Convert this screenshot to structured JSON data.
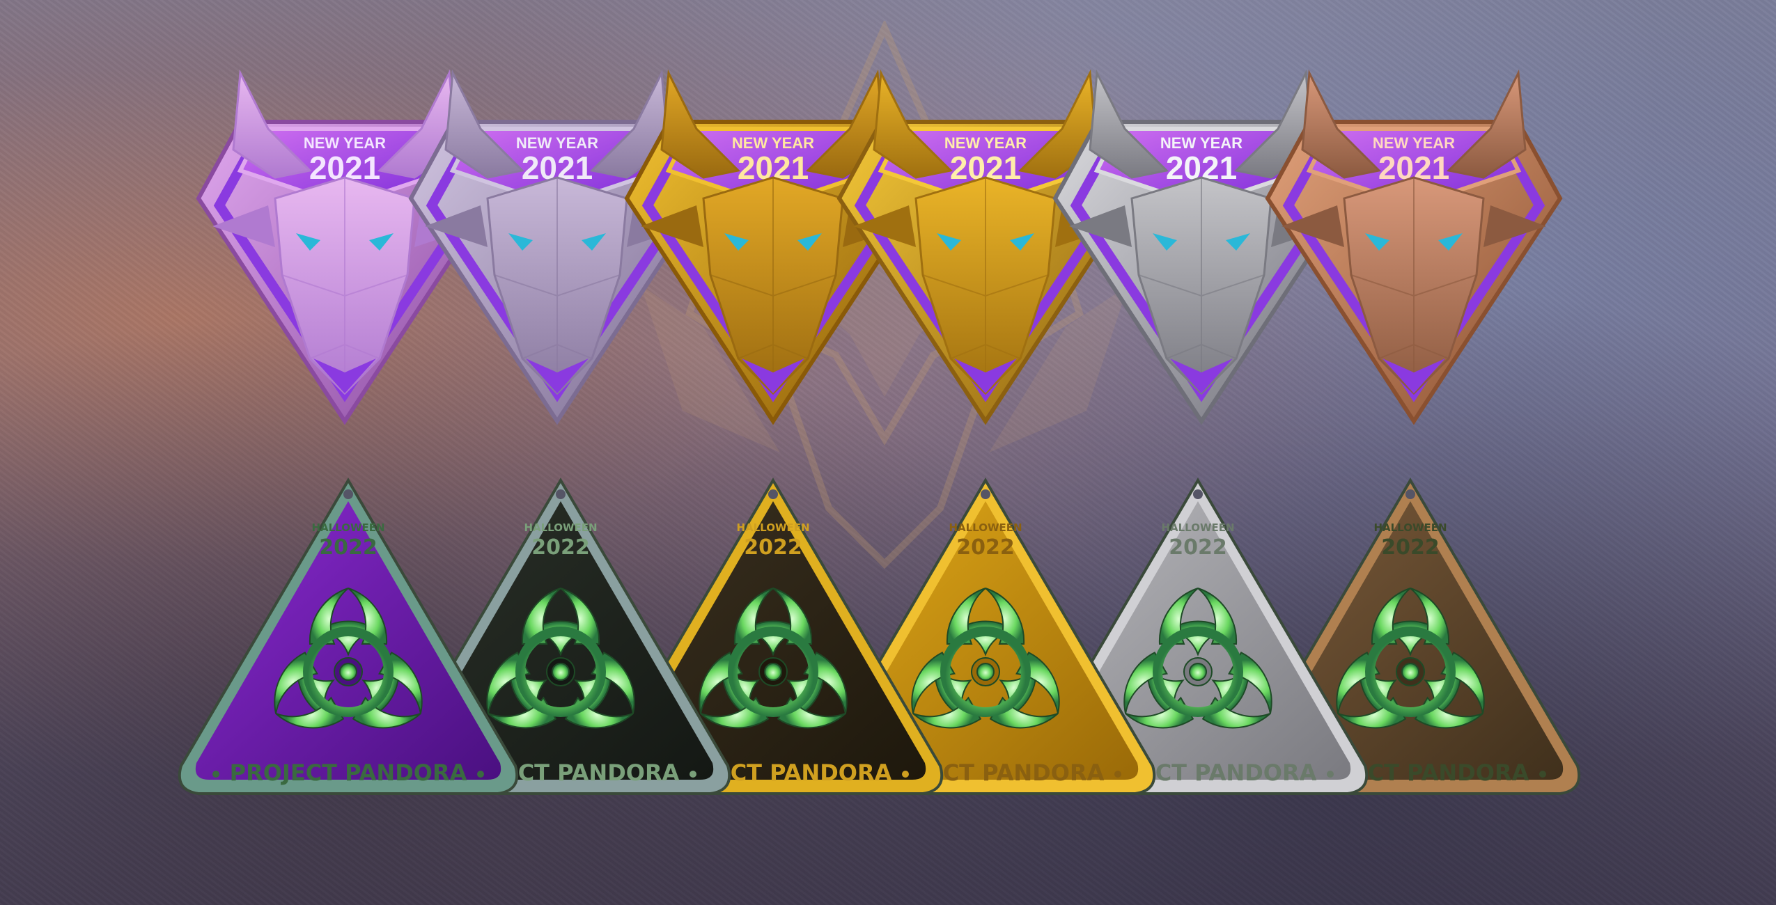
{
  "ox_badges": {
    "label_top": "NEW YEAR",
    "label_year": "2021",
    "variants": [
      {
        "tier": "holographic-pink",
        "body": "#e8b8f0",
        "shade": "#b07ad0",
        "frame": "#e0a8ee",
        "frame_dark": "#8a4aa0",
        "text": "#f4e6ff"
      },
      {
        "tier": "lavender-silver",
        "body": "#c8b8d8",
        "shade": "#8a7aa0",
        "frame": "#d0c4e0",
        "frame_dark": "#7c6c92",
        "text": "#f0eaf8"
      },
      {
        "tier": "gold",
        "body": "#e2a826",
        "shade": "#9a6a10",
        "frame": "#f0c030",
        "frame_dark": "#8a5a08",
        "text": "#ffe8a0"
      },
      {
        "tier": "gold-bright",
        "body": "#eab428",
        "shade": "#a07010",
        "frame": "#f4c838",
        "frame_dark": "#8c6010",
        "text": "#ffeeaa"
      },
      {
        "tier": "silver",
        "body": "#c4c4c8",
        "shade": "#7a7a82",
        "frame": "#dadade",
        "frame_dark": "#6e6e78",
        "text": "#f4f4f8"
      },
      {
        "tier": "bronze",
        "body": "#d8987a",
        "shade": "#8c5a40",
        "frame": "#e0a07a",
        "frame_dark": "#8a5030",
        "text": "#ffd8c0"
      }
    ]
  },
  "hazard_badges": {
    "label_event": "HALLOWEEN",
    "label_year": "2022",
    "label_project": "PROJECT PANDORA",
    "variants": [
      {
        "tier": "purple",
        "plate": "#8a2ad0",
        "plate_dark": "#4a1080",
        "frame": "#6a9a8a",
        "text": "#3a6a40"
      },
      {
        "tier": "dark",
        "plate": "#2a3028",
        "plate_dark": "#141814",
        "frame": "#8aa0a0",
        "text": "#7aa07a"
      },
      {
        "tier": "gold-dark",
        "plate": "#3a3020",
        "plate_dark": "#1e180c",
        "frame": "#e0b020",
        "text": "#d0a020"
      },
      {
        "tier": "gold",
        "plate": "#e0a818",
        "plate_dark": "#9a6a08",
        "frame": "#f0c030",
        "text": "#8a6010"
      },
      {
        "tier": "silver",
        "plate": "#b8b8bc",
        "plate_dark": "#7a7a80",
        "frame": "#d0d0d4",
        "text": "#6a7a6a"
      },
      {
        "tier": "bronze",
        "plate": "#7a5a3a",
        "plate_dark": "#40301c",
        "frame": "#b08050",
        "text": "#3a4a2a"
      }
    ]
  },
  "accent": {
    "gem": "#2ab8d8",
    "purple_band": "#8a3ae0",
    "biohazard_green": "#6ad860",
    "emblem": "#c8a070"
  }
}
